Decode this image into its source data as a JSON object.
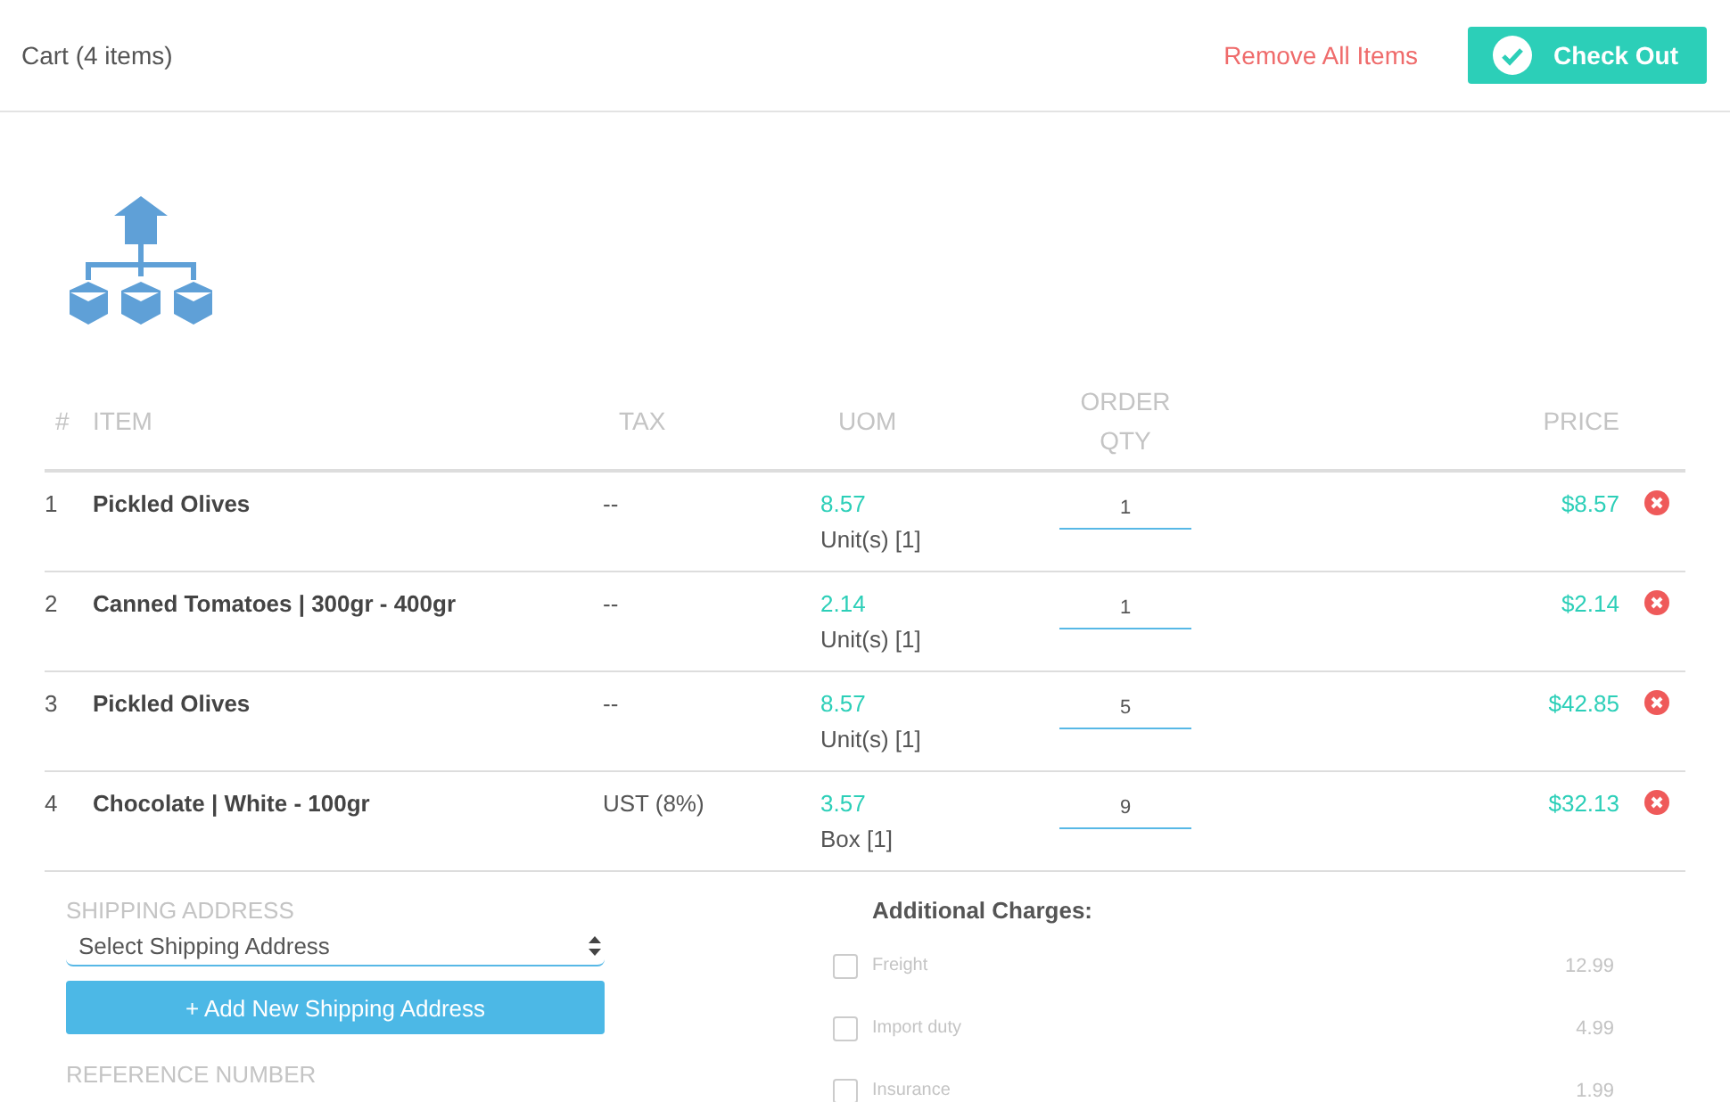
{
  "header": {
    "title": "Cart (4 items)",
    "remove_all": "Remove All Items",
    "checkout": "Check Out"
  },
  "table": {
    "columns": [
      "#",
      "ITEM",
      "TAX",
      "UOM",
      "ORDER QTY",
      "PRICE"
    ],
    "rows": [
      {
        "index": "1",
        "item": "Pickled Olives",
        "tax": "--",
        "uom_price": "8.57",
        "uom": "Unit(s) [1]",
        "qty": "1",
        "price": "$8.57"
      },
      {
        "index": "2",
        "item": "Canned Tomatoes | 300gr - 400gr",
        "tax": "--",
        "uom_price": "2.14",
        "uom": "Unit(s) [1]",
        "qty": "1",
        "price": "$2.14"
      },
      {
        "index": "3",
        "item": "Pickled Olives",
        "tax": "--",
        "uom_price": "8.57",
        "uom": "Unit(s) [1]",
        "qty": "5",
        "price": "$42.85"
      },
      {
        "index": "4",
        "item": "Chocolate | White - 100gr",
        "tax": "UST (8%)",
        "uom_price": "3.57",
        "uom": "Box [1]",
        "qty": "9",
        "price": "$32.13"
      }
    ]
  },
  "shipping": {
    "label": "SHIPPING ADDRESS",
    "select": "Select Shipping Address",
    "add_button": "+ Add New Shipping Address",
    "reference_label": "REFERENCE NUMBER"
  },
  "additional_charges": {
    "title": "Additional Charges:",
    "items": [
      {
        "label": "Freight",
        "amount": "12.99",
        "checked": false
      },
      {
        "label": "Import duty",
        "amount": "4.99",
        "checked": false
      },
      {
        "label": "Insurance",
        "amount": "1.99",
        "checked": false
      }
    ]
  }
}
